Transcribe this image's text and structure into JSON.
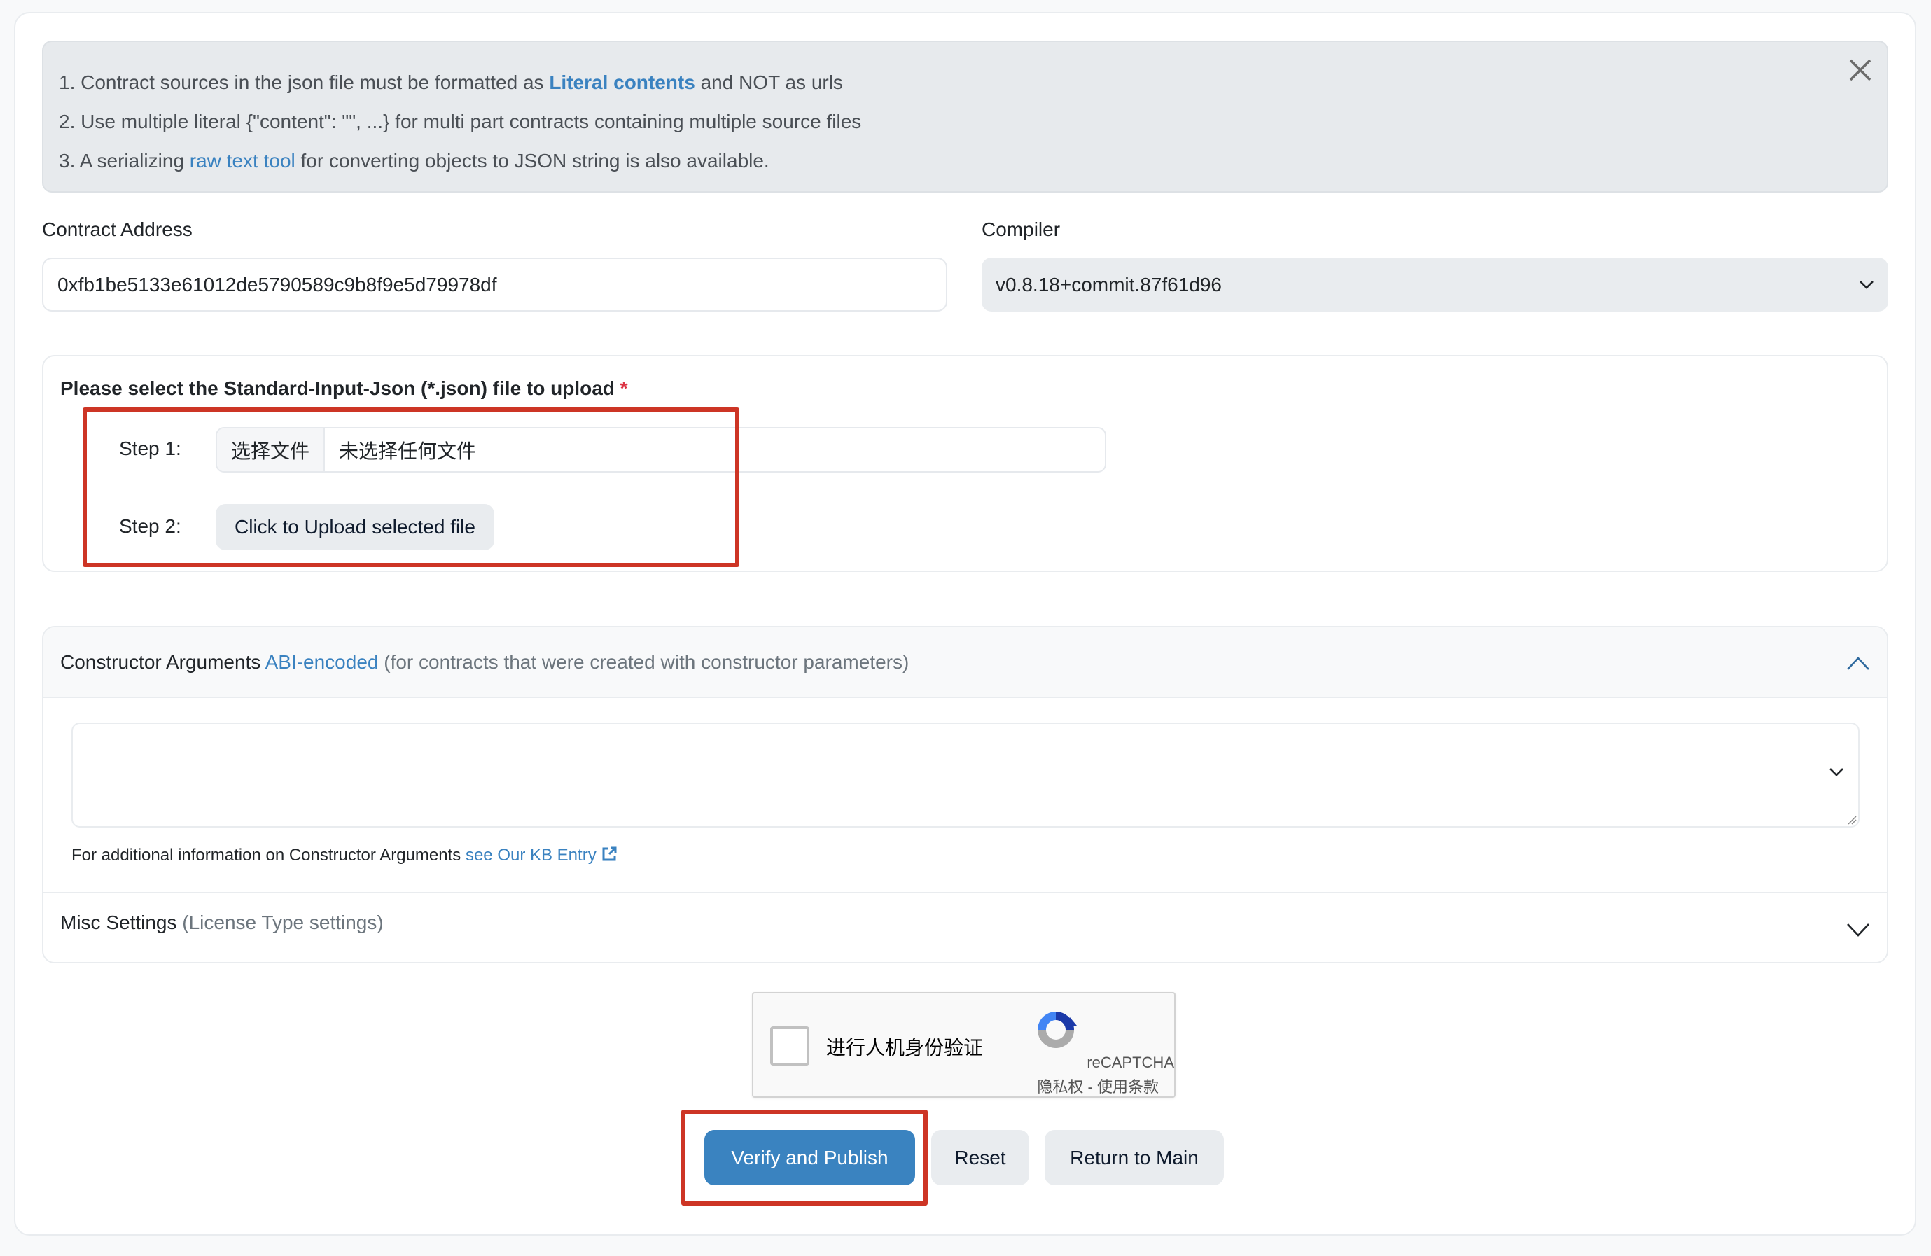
{
  "alert": {
    "line1": {
      "prefix": "1. Contract sources in the json file must be formatted as ",
      "link": "Literal contents",
      "suffix": " and NOT as urls"
    },
    "line2": {
      "text": "2. Use multiple literal {\"content\": \"\", ...} for multi part contracts containing multiple source files"
    },
    "line3": {
      "prefix": "3. A serializing ",
      "link": "raw text tool",
      "suffix": " for converting objects to JSON string is also available."
    },
    "close_icon": "close-icon"
  },
  "contract_address": {
    "label": "Contract Address",
    "value": "0xfb1be5133e61012de5790589c9b8f9e5d79978df"
  },
  "compiler": {
    "label": "Compiler",
    "selected": "v0.8.18+commit.87f61d96"
  },
  "upload": {
    "title": "Please select the Standard-Input-Json (*.json) file to upload",
    "required_mark": "*",
    "step1_label": "Step 1:",
    "choose_file_label": "选择文件",
    "no_file_text": "未选择任何文件",
    "step2_label": "Step 2:",
    "upload_button": "Click to Upload selected file"
  },
  "constructor_args": {
    "title": "Constructor Arguments",
    "link": "ABI-encoded",
    "note": "(for contracts that were created with constructor parameters)",
    "textarea_value": "",
    "help_prefix": "For additional information on Constructor Arguments ",
    "help_link": "see Our KB Entry",
    "expanded": true
  },
  "misc_settings": {
    "title": "Misc Settings",
    "note": "(License Type settings)",
    "expanded": false
  },
  "recaptcha": {
    "label": "进行人机身份验证",
    "brand": "reCAPTCHA",
    "privacy": "隐私权",
    "separator": " - ",
    "terms": "使用条款",
    "checked": false
  },
  "actions": {
    "verify": "Verify and Publish",
    "reset": "Reset",
    "return": "Return to Main"
  },
  "colors": {
    "primary": "#3a83c0",
    "link": "#3a82c0",
    "highlight_box": "#cd3525",
    "alert_bg": "#e7eaed"
  }
}
